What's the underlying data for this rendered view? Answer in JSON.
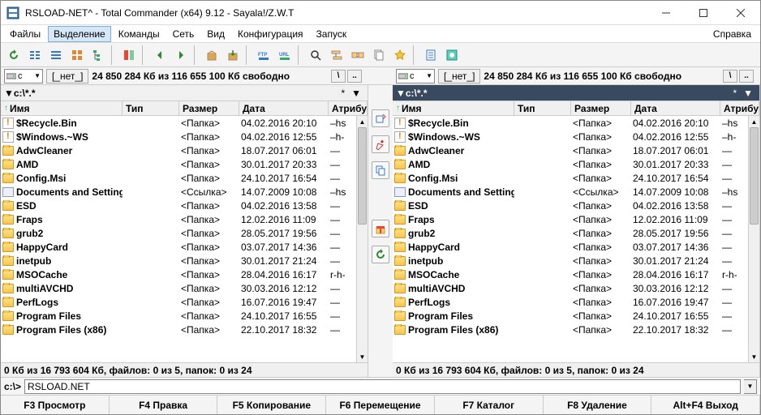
{
  "title": "RSLOAD-NET^ - Total Commander (x64) 9.12 - Sayala!/Z.W.T",
  "menu": {
    "items": [
      "Файлы",
      "Выделение",
      "Команды",
      "Сеть",
      "Вид",
      "Конфигурация",
      "Запуск"
    ],
    "help": "Справка",
    "selected": 1
  },
  "drive": {
    "label": "c",
    "bracket": "[_нет_]",
    "free": "24 850 284 Кб из 116 655 100 Кб свободно"
  },
  "nav": {
    "b1": "\\",
    "b2": "..",
    "dd": "▼"
  },
  "left": {
    "path": "▼c:\\*.*",
    "active": false
  },
  "right": {
    "path": "▼c:\\*.*",
    "active": true
  },
  "headers": {
    "name": "Имя",
    "ext": "Тип",
    "size": "Размер",
    "date": "Дата",
    "attr": "Атрибу"
  },
  "files": [
    {
      "i": "sys",
      "n": "$Recycle.Bin",
      "s": "<Папка>",
      "d": "04.02.2016 20:10",
      "a": "–hs"
    },
    {
      "i": "sys",
      "n": "$Windows.~WS",
      "s": "<Папка>",
      "d": "04.02.2016 12:55",
      "a": "–h-"
    },
    {
      "i": "folder",
      "n": "AdwCleaner",
      "s": "<Папка>",
      "d": "18.07.2017 06:01",
      "a": "—"
    },
    {
      "i": "folder",
      "n": "AMD",
      "s": "<Папка>",
      "d": "30.01.2017 20:33",
      "a": "—"
    },
    {
      "i": "folder",
      "n": "Config.Msi",
      "s": "<Папка>",
      "d": "24.10.2017 16:54",
      "a": "—"
    },
    {
      "i": "link",
      "n": "Documents and Settings",
      "s": "<Ссылка>",
      "d": "14.07.2009 10:08",
      "a": "–hs"
    },
    {
      "i": "folder",
      "n": "ESD",
      "s": "<Папка>",
      "d": "04.02.2016 13:58",
      "a": "—"
    },
    {
      "i": "folder",
      "n": "Fraps",
      "s": "<Папка>",
      "d": "12.02.2016 11:09",
      "a": "—"
    },
    {
      "i": "folder",
      "n": "grub2",
      "s": "<Папка>",
      "d": "28.05.2017 19:56",
      "a": "—"
    },
    {
      "i": "folder",
      "n": "HappyCard",
      "s": "<Папка>",
      "d": "03.07.2017 14:36",
      "a": "—"
    },
    {
      "i": "folder",
      "n": "inetpub",
      "s": "<Папка>",
      "d": "30.01.2017 21:24",
      "a": "—"
    },
    {
      "i": "folder",
      "n": "MSOCache",
      "s": "<Папка>",
      "d": "28.04.2016 16:17",
      "a": "r-h-"
    },
    {
      "i": "folder",
      "n": "multiAVCHD",
      "s": "<Папка>",
      "d": "30.03.2016 12:12",
      "a": "—"
    },
    {
      "i": "folder",
      "n": "PerfLogs",
      "s": "<Папка>",
      "d": "16.07.2016 19:47",
      "a": "—"
    },
    {
      "i": "folder",
      "n": "Program Files",
      "s": "<Папка>",
      "d": "24.10.2017 16:55",
      "a": "—"
    },
    {
      "i": "folder",
      "n": "Program Files (x86)",
      "s": "<Папка>",
      "d": "22.10.2017 18:32",
      "a": "—"
    }
  ],
  "status": "0 Кб из 16 793 604 Кб, файлов: 0 из 5, папок: 0 из 24",
  "cmd": {
    "prompt": "c:\\>",
    "value": "RSLOAD.NET"
  },
  "fkeys": [
    "F3 Просмотр",
    "F4 Правка",
    "F5 Копирование",
    "F6 Перемещение",
    "F7 Каталог",
    "F8 Удаление",
    "Alt+F4 Выход"
  ]
}
